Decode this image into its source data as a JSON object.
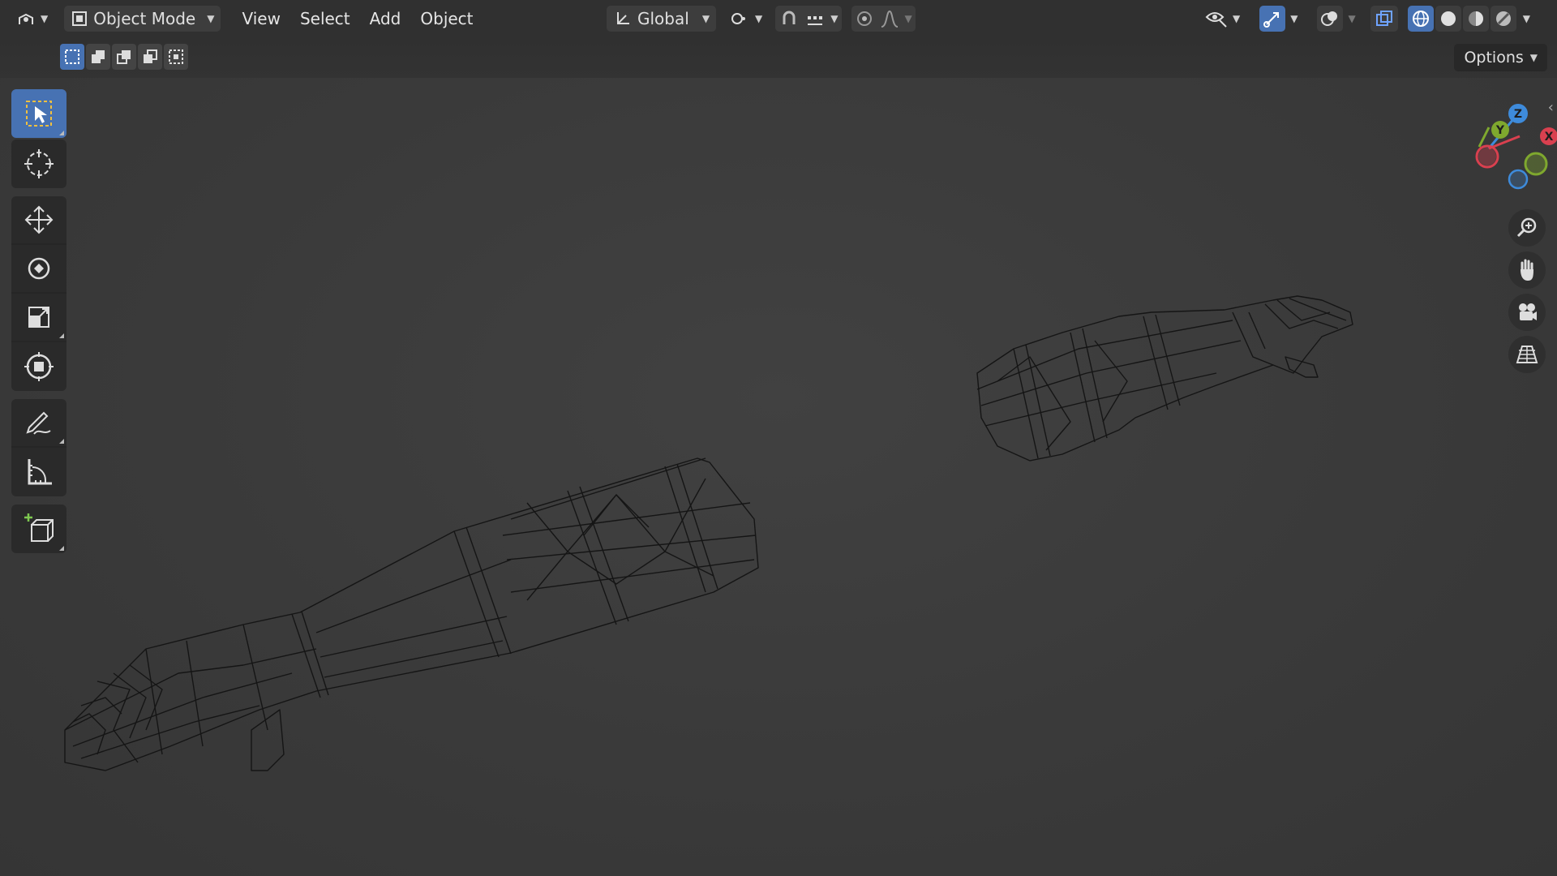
{
  "header": {
    "editor_type_icon": "3d-viewport-icon",
    "mode": {
      "label": "Object Mode",
      "icon": "object-mode-icon"
    },
    "menus": [
      "View",
      "Select",
      "Add",
      "Object"
    ],
    "transform_orientation": {
      "label": "Global",
      "icon": "orientation-axes-icon"
    },
    "pivot_icon": "pivot-point-icon",
    "snap_icon": "magnet-icon",
    "snap_target_icon": "snap-increment-icon",
    "proportional_icon": "proportional-editing-icon",
    "falloff_icon": "falloff-curve-icon",
    "visibility_icon": "eye-selectability-icon",
    "gizmo_icon": "gizmo-toggle-icon",
    "overlay_icon": "overlays-icon",
    "xray_icon": "xray-toggle-icon",
    "shading_modes": [
      "wireframe-shading-icon",
      "solid-shading-icon",
      "material-preview-icon",
      "rendered-shading-icon"
    ]
  },
  "subheader": {
    "selection_modes": [
      "select-new-icon",
      "select-extend-icon",
      "select-subtract-icon",
      "select-difference-icon",
      "select-intersect-icon"
    ],
    "options_label": "Options"
  },
  "toolbar": {
    "tools": [
      "select-box-icon",
      "cursor-icon",
      "move-icon",
      "rotate-icon",
      "scale-icon",
      "transform-icon",
      "annotate-icon",
      "measure-icon",
      "add-cube-icon"
    ]
  },
  "navigation": {
    "gizmo_axes": [
      "Z",
      "Y",
      "X"
    ],
    "buttons": [
      "zoom-icon",
      "pan-hand-icon",
      "camera-view-icon",
      "ortho-grid-icon"
    ]
  },
  "colors": {
    "accent": "#4772b3",
    "axis_x": "#d9404f",
    "axis_y": "#7fa82e",
    "axis_z": "#3e8bdb",
    "viewport_bg": "#3a3a3a",
    "header_bg": "#303030"
  }
}
